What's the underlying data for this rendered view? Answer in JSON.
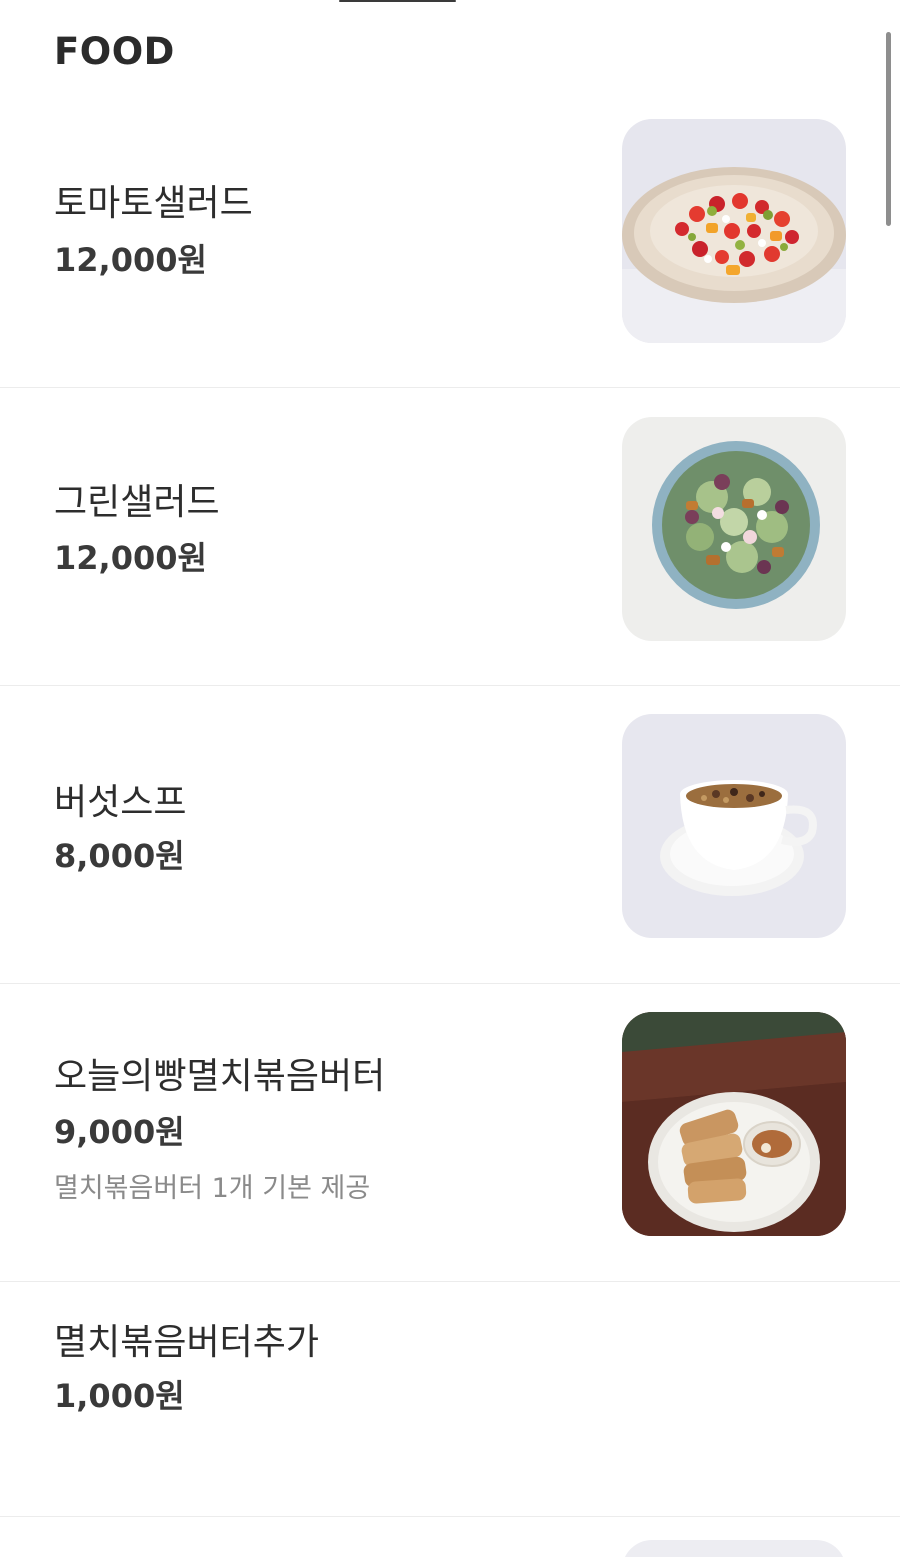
{
  "section": {
    "title": "FOOD"
  },
  "items": [
    {
      "name": "토마토샐러드",
      "price": "12,000원",
      "image_icon": "tomato-salad-photo"
    },
    {
      "name": "그린샐러드",
      "price": "12,000원",
      "image_icon": "green-salad-photo"
    },
    {
      "name": "버섯스프",
      "price": "8,000원",
      "image_icon": "mushroom-soup-photo"
    },
    {
      "name": "오늘의빵멸치볶음버터",
      "price": "9,000원",
      "description": "멸치볶음버터 1개 기본 제공",
      "image_icon": "bread-anchovy-butter-photo"
    },
    {
      "name": "멸치볶음버터추가",
      "price": "1,000원"
    }
  ]
}
